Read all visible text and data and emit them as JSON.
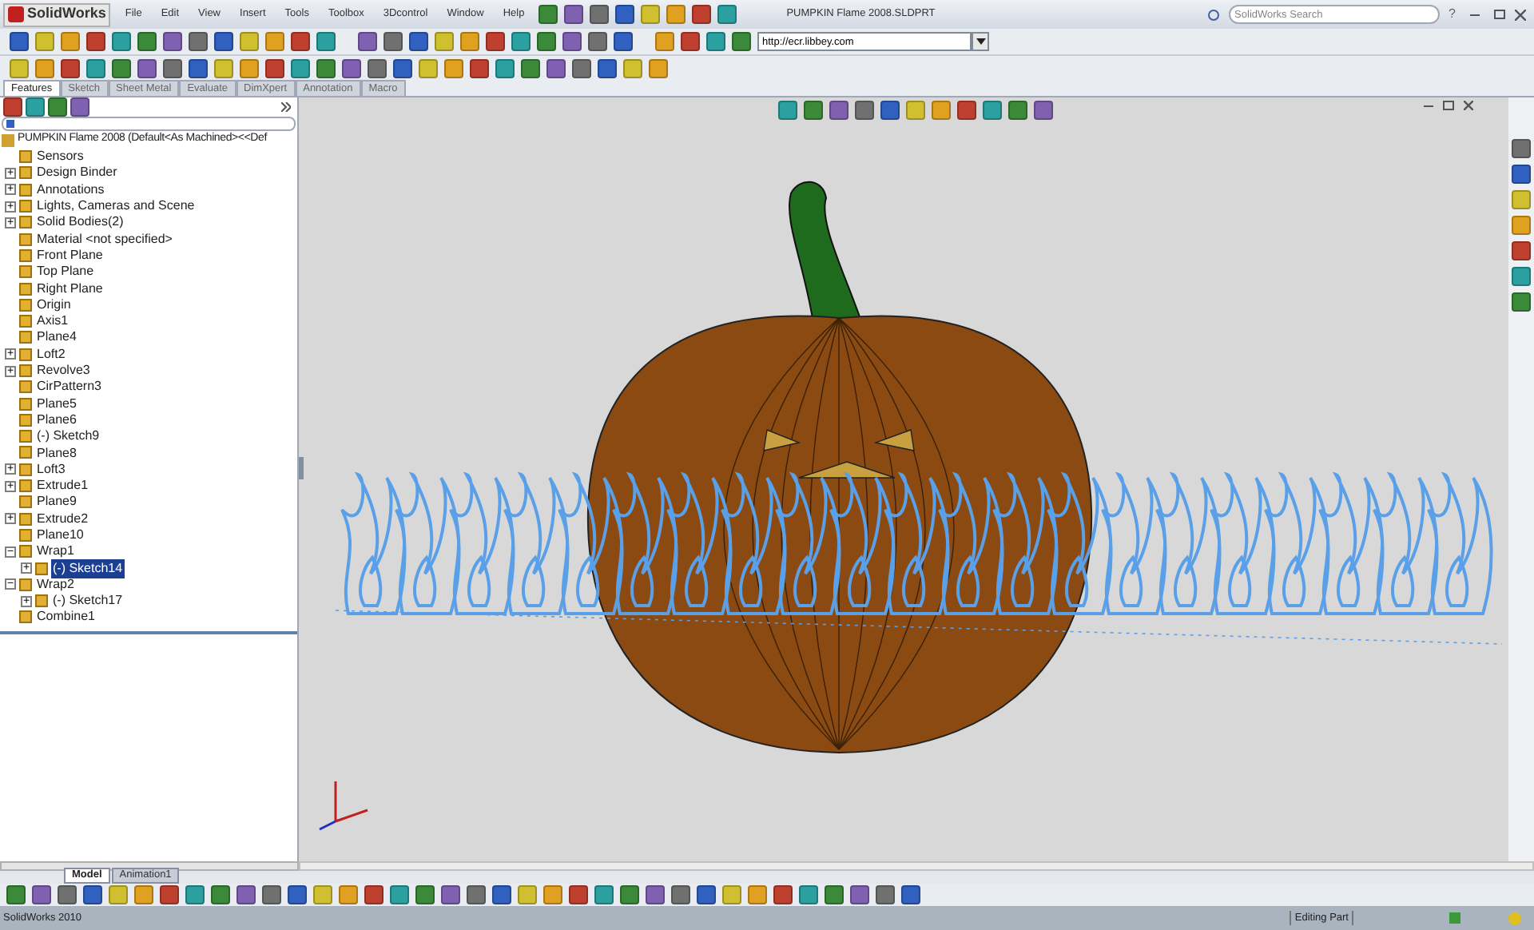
{
  "app": {
    "logo": "SolidWorks",
    "menus": [
      "File",
      "Edit",
      "View",
      "Insert",
      "Tools",
      "Toolbox",
      "3Dcontrol",
      "Window",
      "Help"
    ],
    "title": "PUMPKIN Flame 2008.SLDPRT",
    "search": {
      "placeholder": "SolidWorks Search"
    },
    "help": "?"
  },
  "address": {
    "value": "http://ecr.libbey.com"
  },
  "command_tabs": [
    {
      "label": "Features",
      "selected": true
    },
    {
      "label": "Sketch",
      "selected": false
    },
    {
      "label": "Sheet Metal",
      "selected": false
    },
    {
      "label": "Evaluate",
      "selected": false
    },
    {
      "label": "DimXpert",
      "selected": false
    },
    {
      "label": "Annotation",
      "selected": false
    },
    {
      "label": "Macro",
      "selected": false
    }
  ],
  "tree": {
    "root": "PUMPKIN Flame 2008  (Default<As Machined><<Def",
    "items": [
      {
        "label": "Sensors",
        "selected": false
      },
      {
        "label": "Design Binder",
        "toggle": "+",
        "selected": false
      },
      {
        "label": "Annotations",
        "toggle": "+",
        "selected": false
      },
      {
        "label": "Lights, Cameras and Scene",
        "toggle": "+",
        "selected": false
      },
      {
        "label": "Solid Bodies(2)",
        "toggle": "+",
        "selected": false
      },
      {
        "label": "Material <not specified>",
        "selected": false
      },
      {
        "label": "Front Plane",
        "selected": false
      },
      {
        "label": "Top Plane",
        "selected": false
      },
      {
        "label": "Right Plane",
        "selected": false
      },
      {
        "label": "Origin",
        "selected": false
      },
      {
        "label": "Axis1",
        "selected": false
      },
      {
        "label": "Plane4",
        "selected": false
      },
      {
        "label": "Loft2",
        "toggle": "+",
        "selected": false
      },
      {
        "label": "Revolve3",
        "toggle": "+",
        "selected": false
      },
      {
        "label": "CirPattern3",
        "selected": false
      },
      {
        "label": "Plane5",
        "selected": false
      },
      {
        "label": "Plane6",
        "selected": false
      },
      {
        "label": "(-) Sketch9",
        "selected": false
      },
      {
        "label": "Plane8",
        "selected": false
      },
      {
        "label": "Loft3",
        "toggle": "+",
        "selected": false
      },
      {
        "label": "Extrude1",
        "toggle": "+",
        "selected": false
      },
      {
        "label": "Plane9",
        "selected": false
      },
      {
        "label": "Extrude2",
        "toggle": "+",
        "selected": false
      },
      {
        "label": "Plane10",
        "selected": false
      },
      {
        "label": "Wrap1",
        "toggle": "−",
        "selected": false,
        "children": [
          {
            "label": "(-) Sketch14",
            "toggle": "+",
            "selected": true
          }
        ]
      },
      {
        "label": "Wrap2",
        "toggle": "−",
        "selected": false,
        "children": [
          {
            "label": "(-) Sketch17",
            "toggle": "+",
            "selected": false
          }
        ]
      },
      {
        "label": "Combine1",
        "selected": false
      }
    ]
  },
  "bottom_tabs": [
    {
      "label": "Model",
      "selected": true
    },
    {
      "label": "Animation1",
      "selected": false
    }
  ],
  "status_bar": {
    "left": "SolidWorks 2010",
    "mode": "Editing Part"
  }
}
